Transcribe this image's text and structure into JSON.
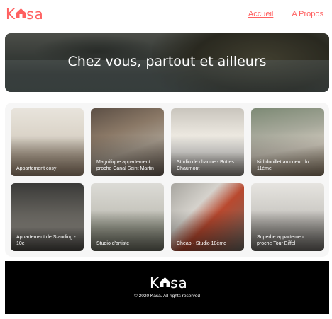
{
  "header": {
    "logo": {
      "pre": "K",
      "post": "sa",
      "icon": "house-icon"
    },
    "nav": {
      "home": "Accueil",
      "about": "A Propos"
    }
  },
  "colors": {
    "brand": "#ff6060",
    "footer_bg": "#000000",
    "gallery_bg": "#f6f6f6",
    "text_light": "#ffffff"
  },
  "banner": {
    "title": "Chez vous, partout et ailleurs"
  },
  "listings": [
    {
      "title": "Appartement cosy"
    },
    {
      "title": "Magnifique appartement proche Canal Saint Martin"
    },
    {
      "title": "Studio de charme - Buttes Chaumont"
    },
    {
      "title": "Nid douillet au coeur du 11ème"
    },
    {
      "title": "Appartement de Standing - 10e"
    },
    {
      "title": "Studio d'artiste"
    },
    {
      "title": "Cheap - Studio 18ème"
    },
    {
      "title": "Superbe appartement proche Tour Eiffel"
    }
  ],
  "footer": {
    "logo": {
      "pre": "K",
      "post": "sa",
      "icon": "house-icon"
    },
    "copyright": "© 2020 Kasa. All rights reserved"
  }
}
